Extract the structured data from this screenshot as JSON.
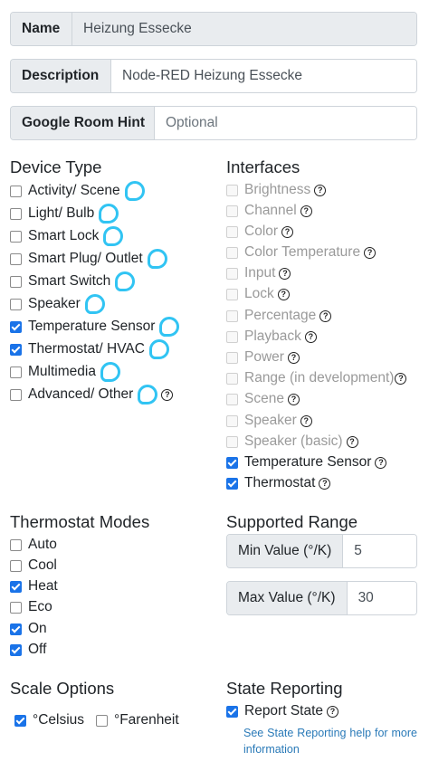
{
  "fields": {
    "name": {
      "label": "Name",
      "value": "Heizung Essecke"
    },
    "description": {
      "label": "Description",
      "value": "Node-RED Heizung Essecke"
    },
    "room_hint": {
      "label": "Google Room Hint",
      "placeholder": "Optional",
      "value": ""
    }
  },
  "device_type": {
    "heading": "Device Type",
    "items": [
      {
        "label": "Activity/ Scene",
        "checked": false,
        "alexa": true
      },
      {
        "label": "Light/ Bulb",
        "checked": false,
        "alexa": true
      },
      {
        "label": "Smart Lock",
        "checked": false,
        "alexa": true
      },
      {
        "label": "Smart Plug/ Outlet",
        "checked": false,
        "alexa": true
      },
      {
        "label": "Smart Switch",
        "checked": false,
        "alexa": true
      },
      {
        "label": "Speaker",
        "checked": false,
        "alexa": true
      },
      {
        "label": "Temperature Sensor",
        "checked": true,
        "alexa": true
      },
      {
        "label": "Thermostat/ HVAC",
        "checked": true,
        "alexa": true
      },
      {
        "label": "Multimedia",
        "checked": false,
        "alexa": true
      },
      {
        "label": "Advanced/ Other",
        "checked": false,
        "alexa": true,
        "help": true
      }
    ]
  },
  "interfaces": {
    "heading": "Interfaces",
    "items": [
      {
        "label": "Brightness",
        "checked": false,
        "disabled": true
      },
      {
        "label": "Channel",
        "checked": false,
        "disabled": true
      },
      {
        "label": "Color",
        "checked": false,
        "disabled": true
      },
      {
        "label": "Color Temperature",
        "checked": false,
        "disabled": true
      },
      {
        "label": "Input",
        "checked": false,
        "disabled": true
      },
      {
        "label": "Lock",
        "checked": false,
        "disabled": true
      },
      {
        "label": "Percentage",
        "checked": false,
        "disabled": true
      },
      {
        "label": "Playback",
        "checked": false,
        "disabled": true
      },
      {
        "label": "Power",
        "checked": false,
        "disabled": true
      },
      {
        "label": "Range (in development)",
        "checked": false,
        "disabled": true
      },
      {
        "label": "Scene",
        "checked": false,
        "disabled": true
      },
      {
        "label": "Speaker",
        "checked": false,
        "disabled": true
      },
      {
        "label": "Speaker (basic)",
        "checked": false,
        "disabled": true
      },
      {
        "label": "Temperature Sensor",
        "checked": true,
        "disabled": false
      },
      {
        "label": "Thermostat",
        "checked": true,
        "disabled": false
      }
    ]
  },
  "thermostat_modes": {
    "heading": "Thermostat Modes",
    "items": [
      {
        "label": "Auto",
        "checked": false
      },
      {
        "label": "Cool",
        "checked": false
      },
      {
        "label": "Heat",
        "checked": true
      },
      {
        "label": "Eco",
        "checked": false
      },
      {
        "label": "On",
        "checked": true
      },
      {
        "label": "Off",
        "checked": true
      }
    ]
  },
  "supported_range": {
    "heading": "Supported Range",
    "min": {
      "label": "Min Value (°/K)",
      "value": "5"
    },
    "max": {
      "label": "Max Value (°/K)",
      "value": "30"
    }
  },
  "scale_options": {
    "heading": "Scale Options",
    "celsius": {
      "label": "°Celsius",
      "checked": true
    },
    "farenheit": {
      "label": "°Farenheit",
      "checked": false
    }
  },
  "state_reporting": {
    "heading": "State Reporting",
    "report_state": {
      "label": "Report State",
      "checked": true
    },
    "help_link": "See State Reporting help for more information"
  },
  "icons": {
    "help": "question-circle-icon",
    "alexa": "alexa-ring-icon"
  },
  "colors": {
    "alexa": "#31c4f3",
    "checkbox": "#1a73e8",
    "link": "#2a7ab8"
  }
}
